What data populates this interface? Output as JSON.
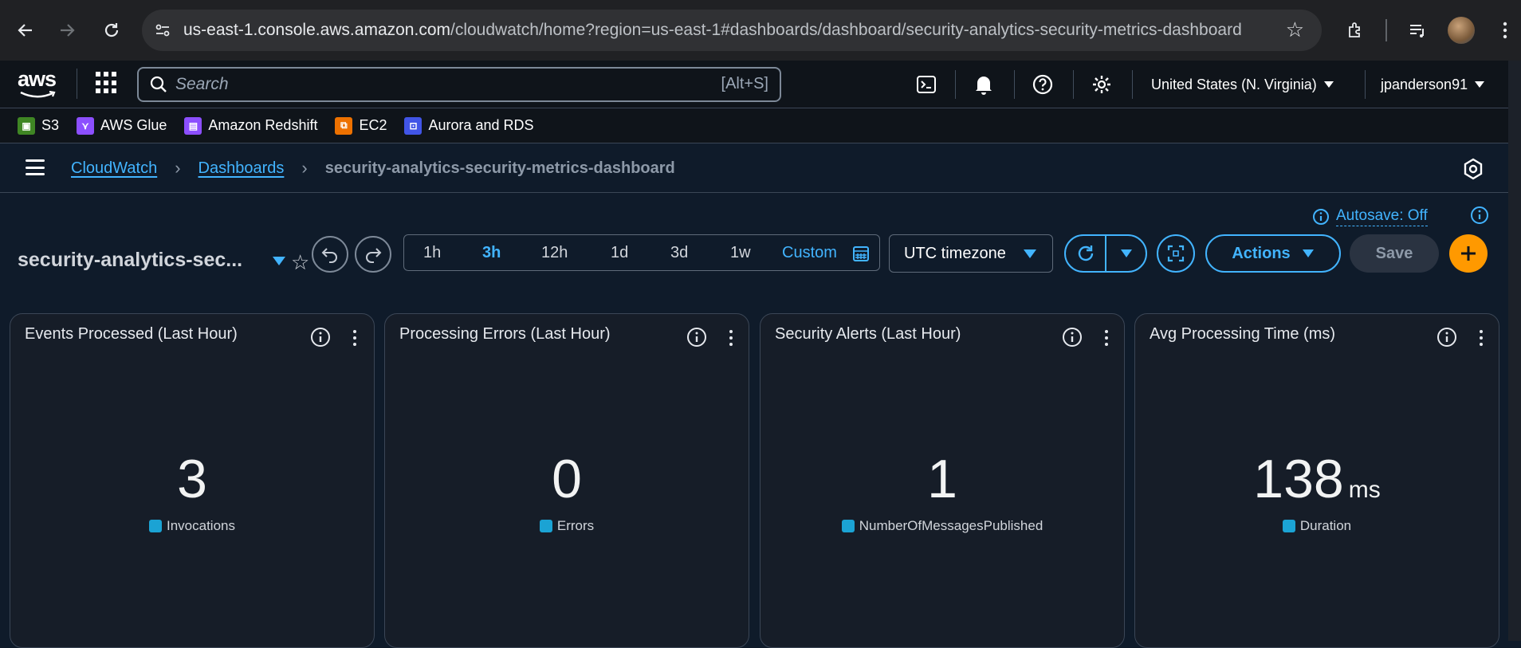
{
  "browser": {
    "url_host": "us-east-1.console.aws.amazon.com",
    "url_path": "/cloudwatch/home?region=us-east-1#dashboards/dashboard/security-analytics-security-metrics-dashboard"
  },
  "aws_nav": {
    "logo": "aws",
    "search_placeholder": "Search",
    "search_shortcut": "[Alt+S]",
    "region": "United States (N. Virginia)",
    "user": "jpanderson91"
  },
  "favorites": [
    {
      "label": "S3",
      "color": "#3f8624"
    },
    {
      "label": "AWS Glue",
      "color": "#8c4fff"
    },
    {
      "label": "Amazon Redshift",
      "color": "#8c4fff"
    },
    {
      "label": "EC2",
      "color": "#ed7100"
    },
    {
      "label": "Aurora and RDS",
      "color": "#4155e7"
    }
  ],
  "breadcrumbs": {
    "items": [
      "CloudWatch",
      "Dashboards"
    ],
    "current": "security-analytics-security-metrics-dashboard"
  },
  "dashboard": {
    "title": "security-analytics-sec...",
    "autosave": "Autosave: Off",
    "time_ranges": [
      "1h",
      "3h",
      "12h",
      "1d",
      "3d",
      "1w"
    ],
    "time_range_active": "3h",
    "custom_label": "Custom",
    "timezone": "UTC timezone",
    "actions_label": "Actions",
    "save_label": "Save"
  },
  "widgets": [
    {
      "title": "Events Processed (Last Hour)",
      "value": "3",
      "unit": "",
      "legend": "Invocations"
    },
    {
      "title": "Processing Errors (Last Hour)",
      "value": "0",
      "unit": "",
      "legend": "Errors"
    },
    {
      "title": "Security Alerts (Last Hour)",
      "value": "1",
      "unit": "",
      "legend": "NumberOfMessagesPublished"
    },
    {
      "title": "Avg Processing Time (ms)",
      "value": "138",
      "unit": "ms",
      "legend": "Duration"
    }
  ],
  "colors": {
    "accent": "#42b4ff",
    "orange": "#ff9900",
    "legend_swatch": "#1ba3d4"
  }
}
